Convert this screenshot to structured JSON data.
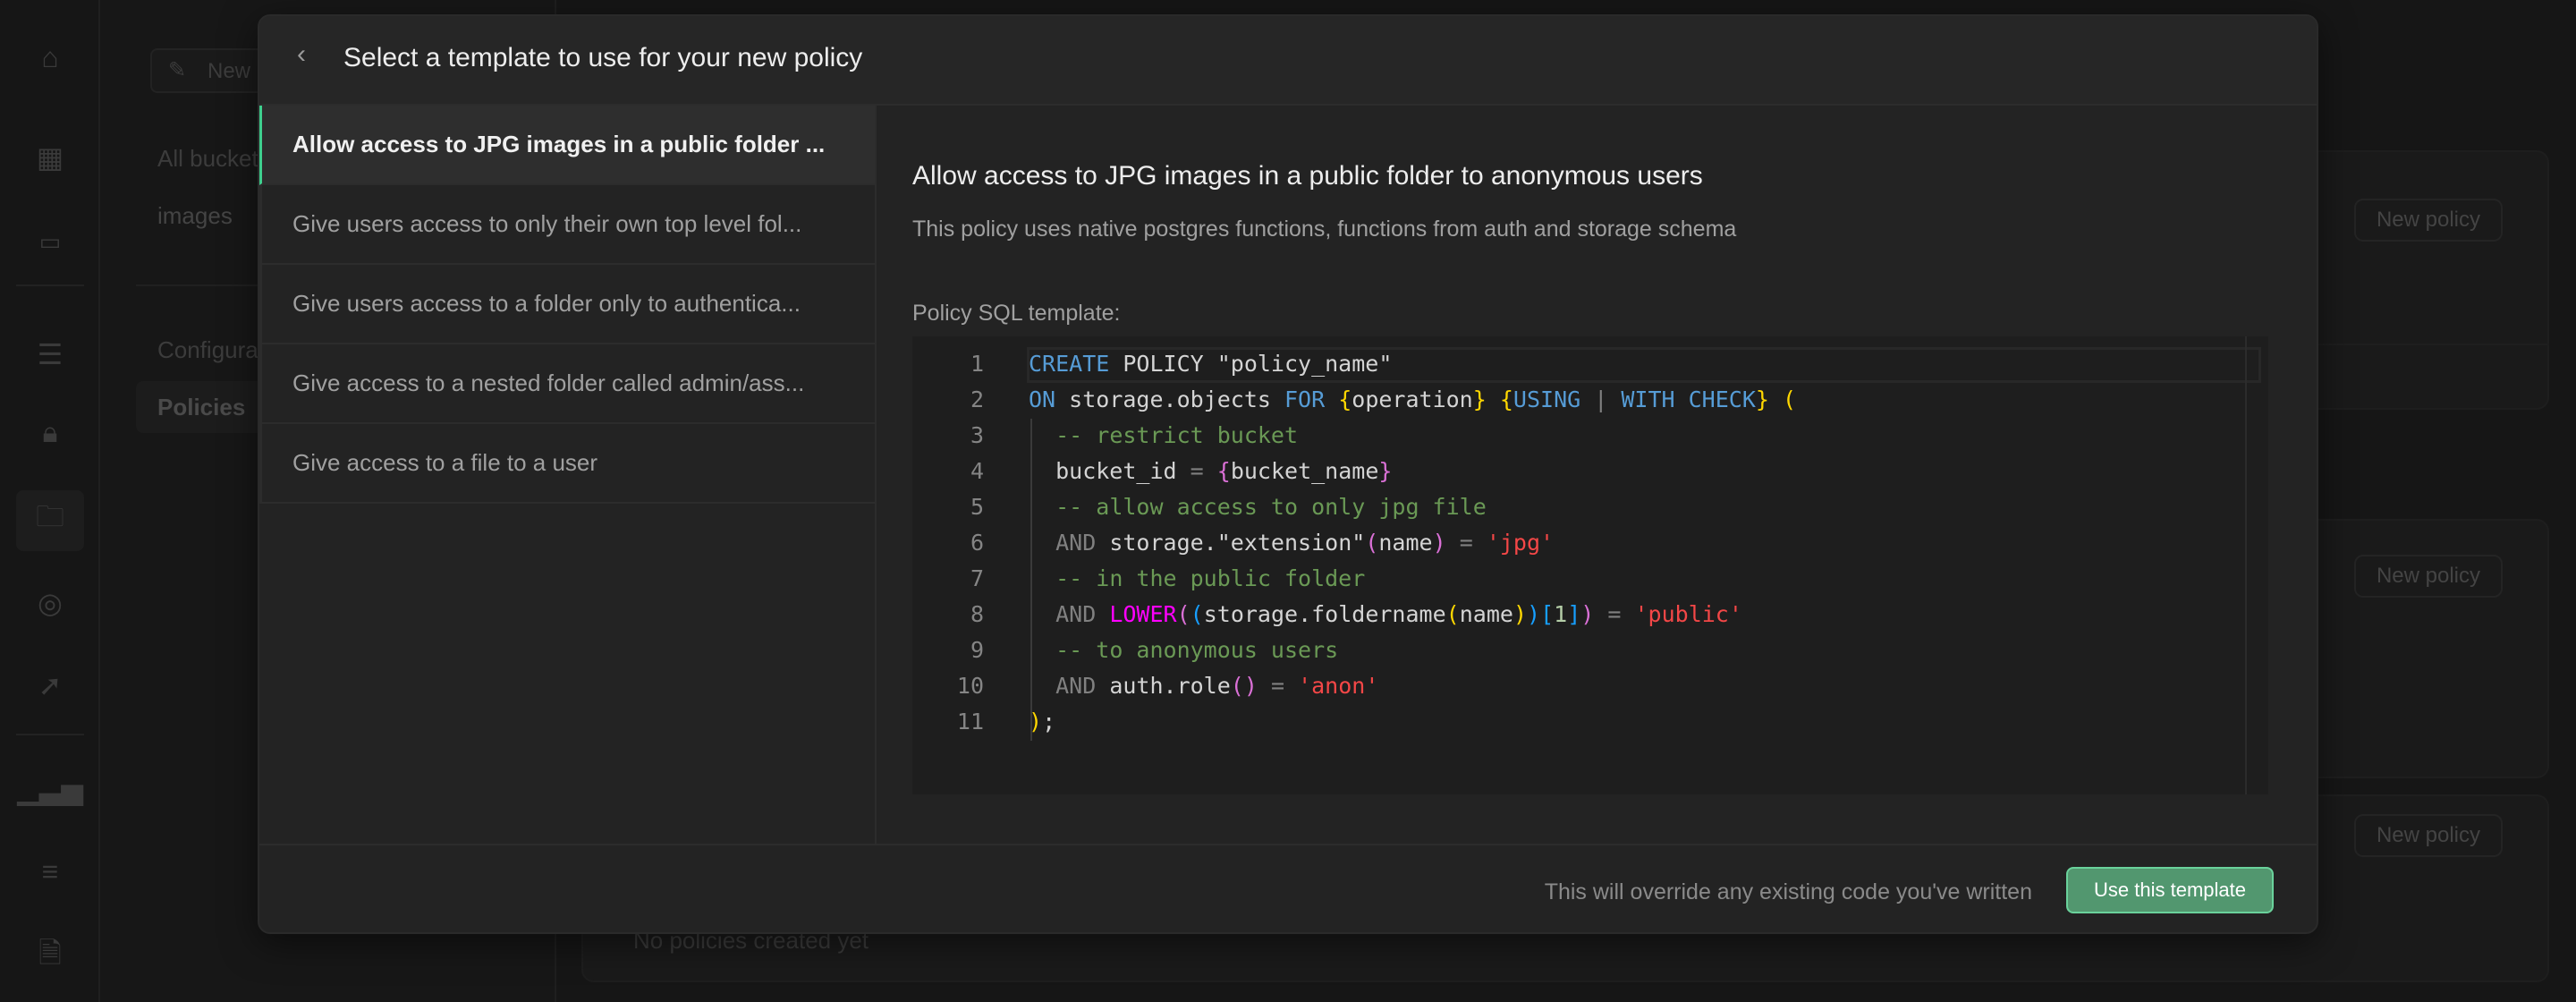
{
  "nav_rail": {
    "icons": [
      "home-icon",
      "table-editor-icon",
      "sql-editor-icon",
      "database-icon",
      "auth-lock-icon",
      "storage-folder-icon",
      "realtime-icon",
      "edge-functions-cursor-icon",
      "reports-chart-icon",
      "logs-list-icon",
      "docs-icon"
    ],
    "active": "storage-folder-icon"
  },
  "storage_sidebar": {
    "new_bucket_label": "New bucket",
    "all_buckets_label": "All buckets",
    "buckets": [
      "images"
    ],
    "configuration_label": "Configuration",
    "policies_label": "Policies"
  },
  "background": {
    "new_policy_label": "New policy",
    "empty_text": "No policies created yet"
  },
  "modal": {
    "title": "Select a template to use for your new policy",
    "templates": [
      "Allow access to JPG images in a public folder ...",
      "Give users access to only their own top level fol...",
      "Give users access to a folder only to authentica...",
      "Give access to a nested folder called admin/ass...",
      "Give access to a file to a user"
    ],
    "selected_index": 0,
    "detail": {
      "title": "Allow access to JPG images in a public folder to anonymous users",
      "description": "This policy uses native postgres functions, functions from auth and storage schema",
      "sql_label": "Policy SQL template:",
      "line_numbers": [
        "1",
        "2",
        "3",
        "4",
        "5",
        "6",
        "7",
        "8",
        "9",
        "10",
        "11"
      ]
    },
    "footer": {
      "note": "This will override any existing code you've written",
      "use_button": "Use this template"
    }
  },
  "colors": {
    "accent": "#3ecf8e",
    "button": "#52976f",
    "background": "#161616",
    "modal": "#232323"
  }
}
